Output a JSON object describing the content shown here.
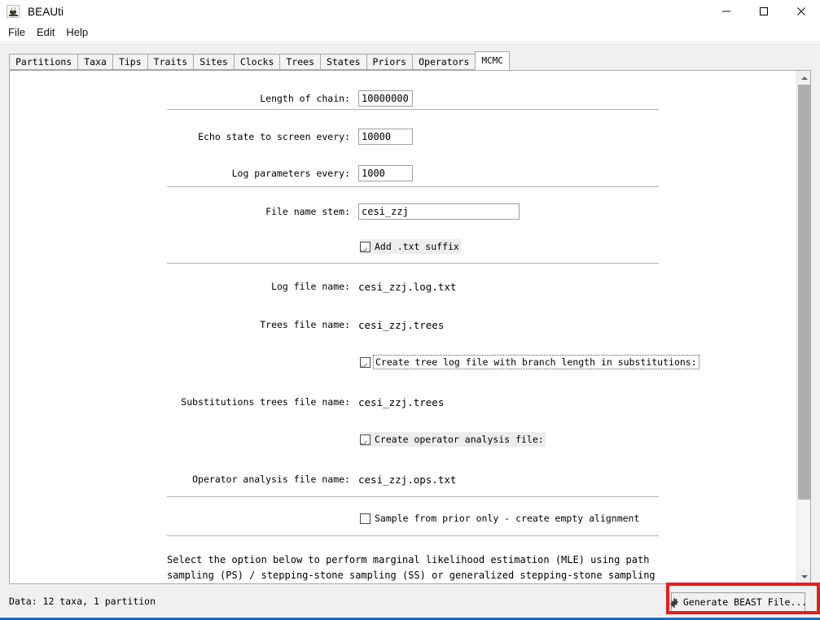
{
  "window": {
    "title": "BEAUti",
    "app_icon": "java-cup-icon",
    "controls": {
      "minimize": "minimize-icon",
      "maximize": "maximize-icon",
      "close": "close-icon"
    }
  },
  "menubar": {
    "items": [
      {
        "label": "File"
      },
      {
        "label": "Edit"
      },
      {
        "label": "Help"
      }
    ]
  },
  "tabs": [
    {
      "label": "Partitions",
      "active": false
    },
    {
      "label": "Taxa",
      "active": false
    },
    {
      "label": "Tips",
      "active": false
    },
    {
      "label": "Traits",
      "active": false
    },
    {
      "label": "Sites",
      "active": false
    },
    {
      "label": "Clocks",
      "active": false
    },
    {
      "label": "Trees",
      "active": false
    },
    {
      "label": "States",
      "active": false
    },
    {
      "label": "Priors",
      "active": false
    },
    {
      "label": "Operators",
      "active": false
    },
    {
      "label": "MCMC",
      "active": true
    }
  ],
  "form": {
    "chain_length": {
      "label": "Length of chain:",
      "value": "10000000"
    },
    "echo_state": {
      "label": "Echo state to screen every:",
      "value": "10000"
    },
    "log_parameters": {
      "label": "Log parameters every:",
      "value": "1000"
    },
    "file_name_stem": {
      "label": "File name stem:",
      "value": "cesi_zzj"
    },
    "add_txt_suffix": {
      "label": "Add .txt suffix",
      "checked": true
    },
    "log_file_name": {
      "label": "Log file name:",
      "value": "cesi_zzj.log.txt"
    },
    "trees_file_name": {
      "label": "Trees file name:",
      "value": "cesi_zzj.trees"
    },
    "create_tree_log_subs": {
      "label": "Create tree log file with branch length in substitutions:",
      "checked": true
    },
    "subs_trees_file_name": {
      "label": "Substitutions trees file name:",
      "value": "cesi_zzj.trees"
    },
    "create_operator_analysis": {
      "label": "Create operator analysis file:",
      "checked": true
    },
    "operator_analysis_file_name": {
      "label": "Operator analysis file name:",
      "value": "cesi_zzj.ops.txt"
    },
    "sample_from_prior": {
      "label": "Sample from prior only - create empty alignment",
      "checked": false
    },
    "mle_note": "Select the option below to perform marginal likelihood estimation (MLE) using path\nsampling (PS) / stepping-stone sampling (SS) or generalized stepping-stone sampling"
  },
  "statusbar": {
    "status_text": "Data: 12 taxa, 1 partition",
    "generate_button": {
      "label": "Generate BEAST File...",
      "icon": "gear-icon"
    }
  },
  "annotation": {
    "color": "#ef1b1b"
  }
}
